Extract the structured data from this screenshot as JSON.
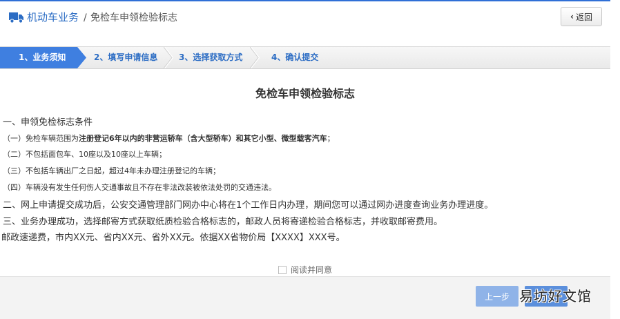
{
  "header": {
    "breadcrumb_main": "机动车业务",
    "breadcrumb_sep": "/",
    "breadcrumb_sub": "免检车申领检验标志",
    "back_label": "返回"
  },
  "steps": [
    {
      "label": "1、业务须知",
      "active": true
    },
    {
      "label": "2、填写申请信息",
      "active": false
    },
    {
      "label": "3、选择获取方式",
      "active": false
    },
    {
      "label": "4、确认提交",
      "active": false
    }
  ],
  "document": {
    "title": "免检车申领检验标志",
    "section1_heading": "一、申领免检标志条件",
    "item1_prefix": "（一）免检车辆范围为",
    "item1_bold": "注册登记6年以内的非营运轿车（含大型轿车）和其它小型、微型载客汽车",
    "item1_suffix": "；",
    "item2": "（二）不包括面包车、10座以及10座以上车辆；",
    "item3": "（三）不包括车辆出厂之日起，超过4年未办理注册登记的车辆；",
    "item4": "（四）车辆没有发生任何伤人交通事故且不存在非法改装被依法处罚的交通违法。",
    "section2": "二、网上申请提交成功后，公安交通管理部门网办中心将在1个工作日内办理，期间您可以通过网办进度查询业务办理进度。",
    "section3": "三、业务办理成功，选择邮寄方式获取纸质检验合格标志的，邮政人员将寄递检验合格标志，并收取邮寄费用。",
    "section4": "邮政速递费，市内XX元、省内XX元、省外XX元。依据XX省物价局【XXXX】XXX号。"
  },
  "agree_label": "阅读并同意",
  "footer": {
    "prev_label": "上一步",
    "watermark": "易坊好文馆"
  },
  "colors": {
    "accent": "#2f6fd6",
    "step_active": "#3f7fe0",
    "link": "#2b6cc4"
  }
}
